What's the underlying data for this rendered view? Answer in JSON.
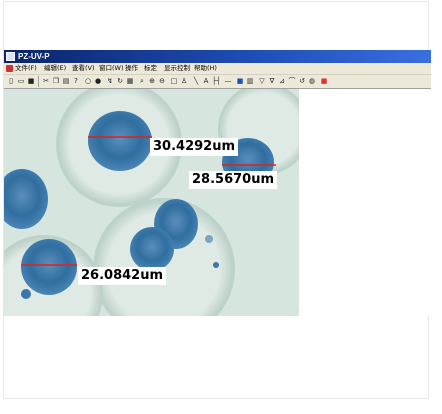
{
  "window": {
    "title": "PZ-UV-P",
    "menu": [
      "文件(F)",
      "编辑(E)",
      "查看(V)",
      "窗口(W)",
      "操作",
      "标定",
      "显示控制",
      "帮助(H)"
    ]
  },
  "toolbar": {
    "icons": [
      "new-file-icon",
      "open-file-icon",
      "save-icon",
      "cut-icon",
      "copy-icon",
      "print-icon",
      "help-icon",
      "circle-icon",
      "filled-circle-icon",
      "curve-icon",
      "rotate-icon",
      "grid-icon",
      "zoom-icon",
      "zoom-in-icon",
      "zoom-out-icon",
      "rectangle-icon",
      "marker-icon",
      "line-icon",
      "text-icon",
      "width-icon",
      "minus-icon",
      "palette-icon",
      "bars-icon",
      "filter-icon",
      "angle-icon",
      "measure-icon",
      "arc-icon",
      "redo-icon",
      "color-icon",
      "stop-icon"
    ]
  },
  "measurements": [
    {
      "value": "30.4292um",
      "color": "#e02020"
    },
    {
      "value": "28.5670um",
      "color": "#e02020"
    },
    {
      "value": "26.0842um",
      "color": "#e02020"
    }
  ],
  "colors": {
    "title_bar": "#1f4fb8",
    "background": "#cfe0da",
    "cell_stain": "#2f6e9f",
    "measure_line": "#e02020"
  }
}
